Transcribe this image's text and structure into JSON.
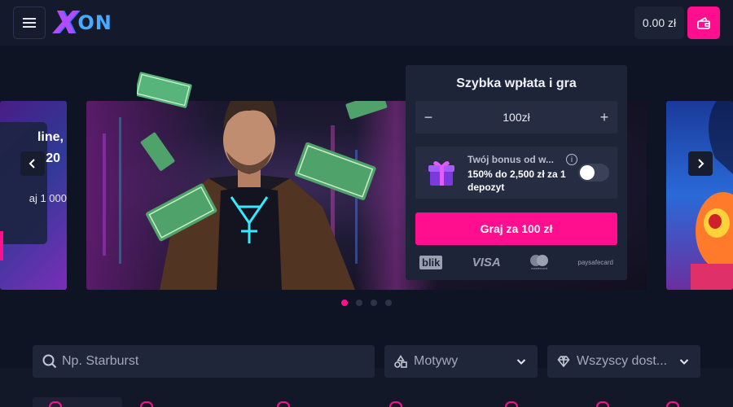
{
  "header": {
    "logo_text_x": "X",
    "logo_text_on": "ON",
    "balance": "0.00 zł"
  },
  "banner_left": {
    "line1": "line,",
    "line2": "20",
    "line3": "aj 1 000"
  },
  "quick_deposit": {
    "title": "Szybka wpłata i gra",
    "amount": "100zł",
    "minus": "−",
    "plus": "+",
    "bonus_title": "Twój bonus od w...",
    "bonus_desc": "150% do 2,500 zł za 1 depozyt",
    "info": "i",
    "play_button": "Graj za 100 zł",
    "payments": {
      "blik": "blik",
      "visa": "VISA",
      "mastercard": "mastercard",
      "paysafecard": "paysafecard"
    }
  },
  "carousel": {
    "slide_count": 4,
    "active_index": 0
  },
  "filters": {
    "search_placeholder": "Np. Starburst",
    "theme_label": "Motywy",
    "provider_label": "Wszyscy dost..."
  },
  "colors": {
    "accent": "#ff0f8d",
    "background": "#0f1424",
    "panel": "#1e2438"
  }
}
